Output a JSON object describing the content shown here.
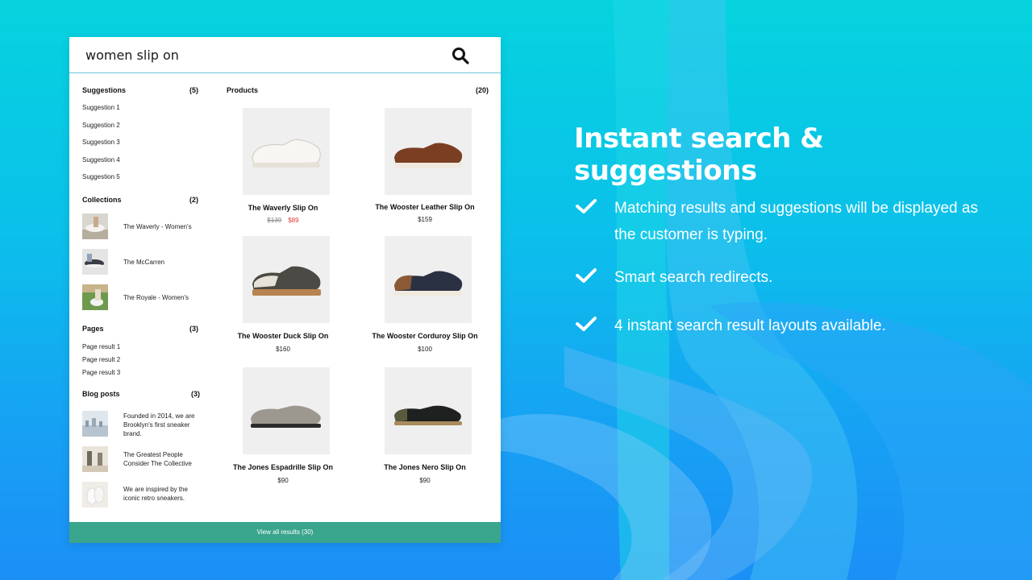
{
  "search": {
    "value": "women slip on",
    "placeholder": "Search"
  },
  "suggestions": {
    "title": "Suggestions",
    "count": "(5)",
    "items": [
      "Suggestion 1",
      "Suggestion 2",
      "Suggestion 3",
      "Suggestion 4",
      "Suggestion 5"
    ]
  },
  "collections": {
    "title": "Collections",
    "count": "(2)",
    "items": [
      "The Waverly - Women's",
      "The McCarren",
      "The Royale - Women's"
    ]
  },
  "pages": {
    "title": "Pages",
    "count": "(3)",
    "items": [
      "Page result 1",
      "Page result 2",
      "Page result 3"
    ]
  },
  "blog": {
    "title": "Blog posts",
    "count": "(3)",
    "items": [
      "Founded in 2014, we are Brooklyn's first sneaker brand.",
      "The Greatest People Consider The Collective",
      "We are inspired by the iconic retro sneakers."
    ]
  },
  "products": {
    "title": "Products",
    "count": "(20)",
    "items": [
      {
        "name": "The Waverly Slip On",
        "old_price": "$139",
        "price": "$89"
      },
      {
        "name": "The Wooster Leather Slip On",
        "price": "$159"
      },
      {
        "name": "The Wooster Duck Slip On",
        "price": "$160"
      },
      {
        "name": "The Wooster Corduroy Slip On",
        "price": "$100"
      },
      {
        "name": "The Jones Espadrille Slip On",
        "price": "$90"
      },
      {
        "name": "The Jones Nero Slip On",
        "price": "$90"
      }
    ]
  },
  "view_all": "View all results (30)",
  "marketing": {
    "headline": "Instant search & suggestions",
    "features": [
      "Matching results and suggestions will be displayed as the customer is typing.",
      "Smart search redirects.",
      "4 instant search result layouts available."
    ]
  },
  "colors": {
    "accent_green": "#3aa58d",
    "sale_red": "#e0403a",
    "background_cyan": "#06d3de",
    "background_blue": "#1b8ff6"
  }
}
